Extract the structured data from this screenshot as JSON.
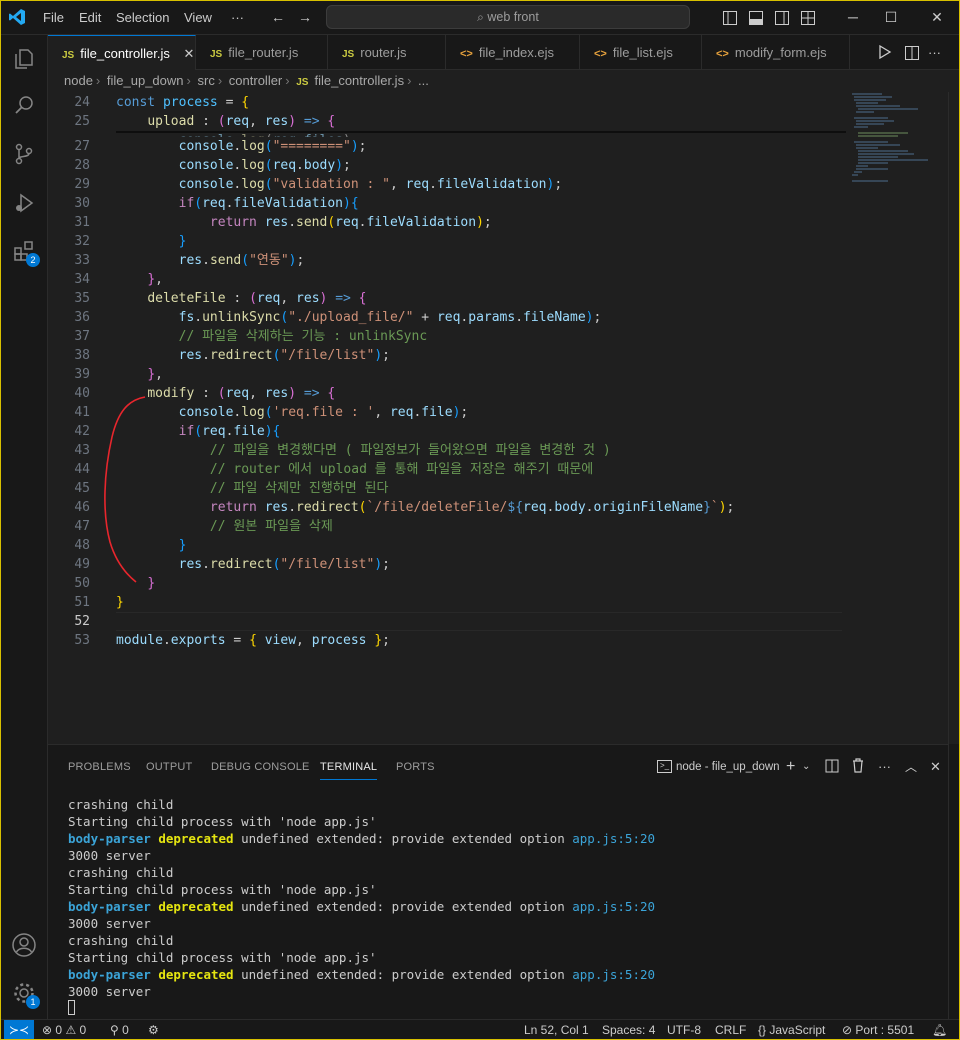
{
  "titlebar": {
    "menu": [
      "File",
      "Edit",
      "Selection",
      "View",
      "···"
    ],
    "search_text": "web front"
  },
  "activity": {
    "extensions_badge": "2",
    "settings_badge": "1"
  },
  "tabs": [
    {
      "label": "file_controller.js",
      "kind": "js",
      "active": true
    },
    {
      "label": "file_router.js",
      "kind": "js"
    },
    {
      "label": "router.js",
      "kind": "js"
    },
    {
      "label": "file_index.ejs",
      "kind": "ejs"
    },
    {
      "label": "file_list.ejs",
      "kind": "ejs"
    },
    {
      "label": "modify_form.ejs",
      "kind": "ejs"
    }
  ],
  "breadcrumb": [
    "node",
    "file_up_down",
    "src",
    "controller",
    "file_controller.js",
    "..."
  ],
  "editor": {
    "lines": [
      24,
      25,
      27,
      28,
      29,
      30,
      31,
      32,
      33,
      34,
      35,
      36,
      37,
      38,
      39,
      40,
      41,
      42,
      43,
      44,
      45,
      46,
      47,
      48,
      49,
      50,
      51,
      52,
      53
    ],
    "comments": {
      "c37": "// 파일을 삭제하는 기능 : unlinkSync",
      "c43": "// 파일을 변경했다면 ( 파일정보가 들어왔으면 파일을 변경한 것 )",
      "c44": "// router 에서 upload 를 통해 파일을 저장은 해주기 때문에",
      "c45": "// 파일 삭제만 진행하면 된다",
      "c47": "// 원본 파일을 삭제"
    },
    "strings": {
      "s27": "\"========\"",
      "s29": "\"validation : \"",
      "s33": "\"연동\"",
      "s36": "\"./upload_file/\"",
      "s38": "\"/file/list\"",
      "s41": "'req.file : '",
      "s46a": "`/file/deleteFile/",
      "s46b": "`",
      "s49": "\"/file/list\""
    }
  },
  "panel": {
    "tabs": [
      "PROBLEMS",
      "OUTPUT",
      "DEBUG CONSOLE",
      "TERMINAL",
      "PORTS"
    ],
    "active_tab": "TERMINAL",
    "terminal_name": "node - file_up_down",
    "terminal_lines": [
      {
        "type": "plain",
        "text": "crashing child"
      },
      {
        "type": "plain",
        "text": "Starting child process with 'node app.js'"
      },
      {
        "type": "warn",
        "a": "body-parser",
        "b": "deprecated",
        "c": " undefined extended: provide extended option ",
        "d": "app.js:5:20"
      },
      {
        "type": "plain",
        "text": "3000 server"
      },
      {
        "type": "plain",
        "text": "crashing child"
      },
      {
        "type": "plain",
        "text": "Starting child process with 'node app.js'"
      },
      {
        "type": "warn",
        "a": "body-parser",
        "b": "deprecated",
        "c": " undefined extended: provide extended option ",
        "d": "app.js:5:20"
      },
      {
        "type": "plain",
        "text": "3000 server"
      },
      {
        "type": "plain",
        "text": "crashing child"
      },
      {
        "type": "plain",
        "text": "Starting child process with 'node app.js'"
      },
      {
        "type": "warn",
        "a": "body-parser",
        "b": "deprecated",
        "c": " undefined extended: provide extended option ",
        "d": "app.js:5:20"
      },
      {
        "type": "plain",
        "text": "3000 server"
      }
    ]
  },
  "status": {
    "errors": "0",
    "warnings": "0",
    "ports_fwd": "0",
    "position": "Ln 52, Col 1",
    "spaces": "Spaces: 4",
    "encoding": "UTF-8",
    "eol": "CRLF",
    "language": "JavaScript",
    "port": "Port : 5501"
  }
}
